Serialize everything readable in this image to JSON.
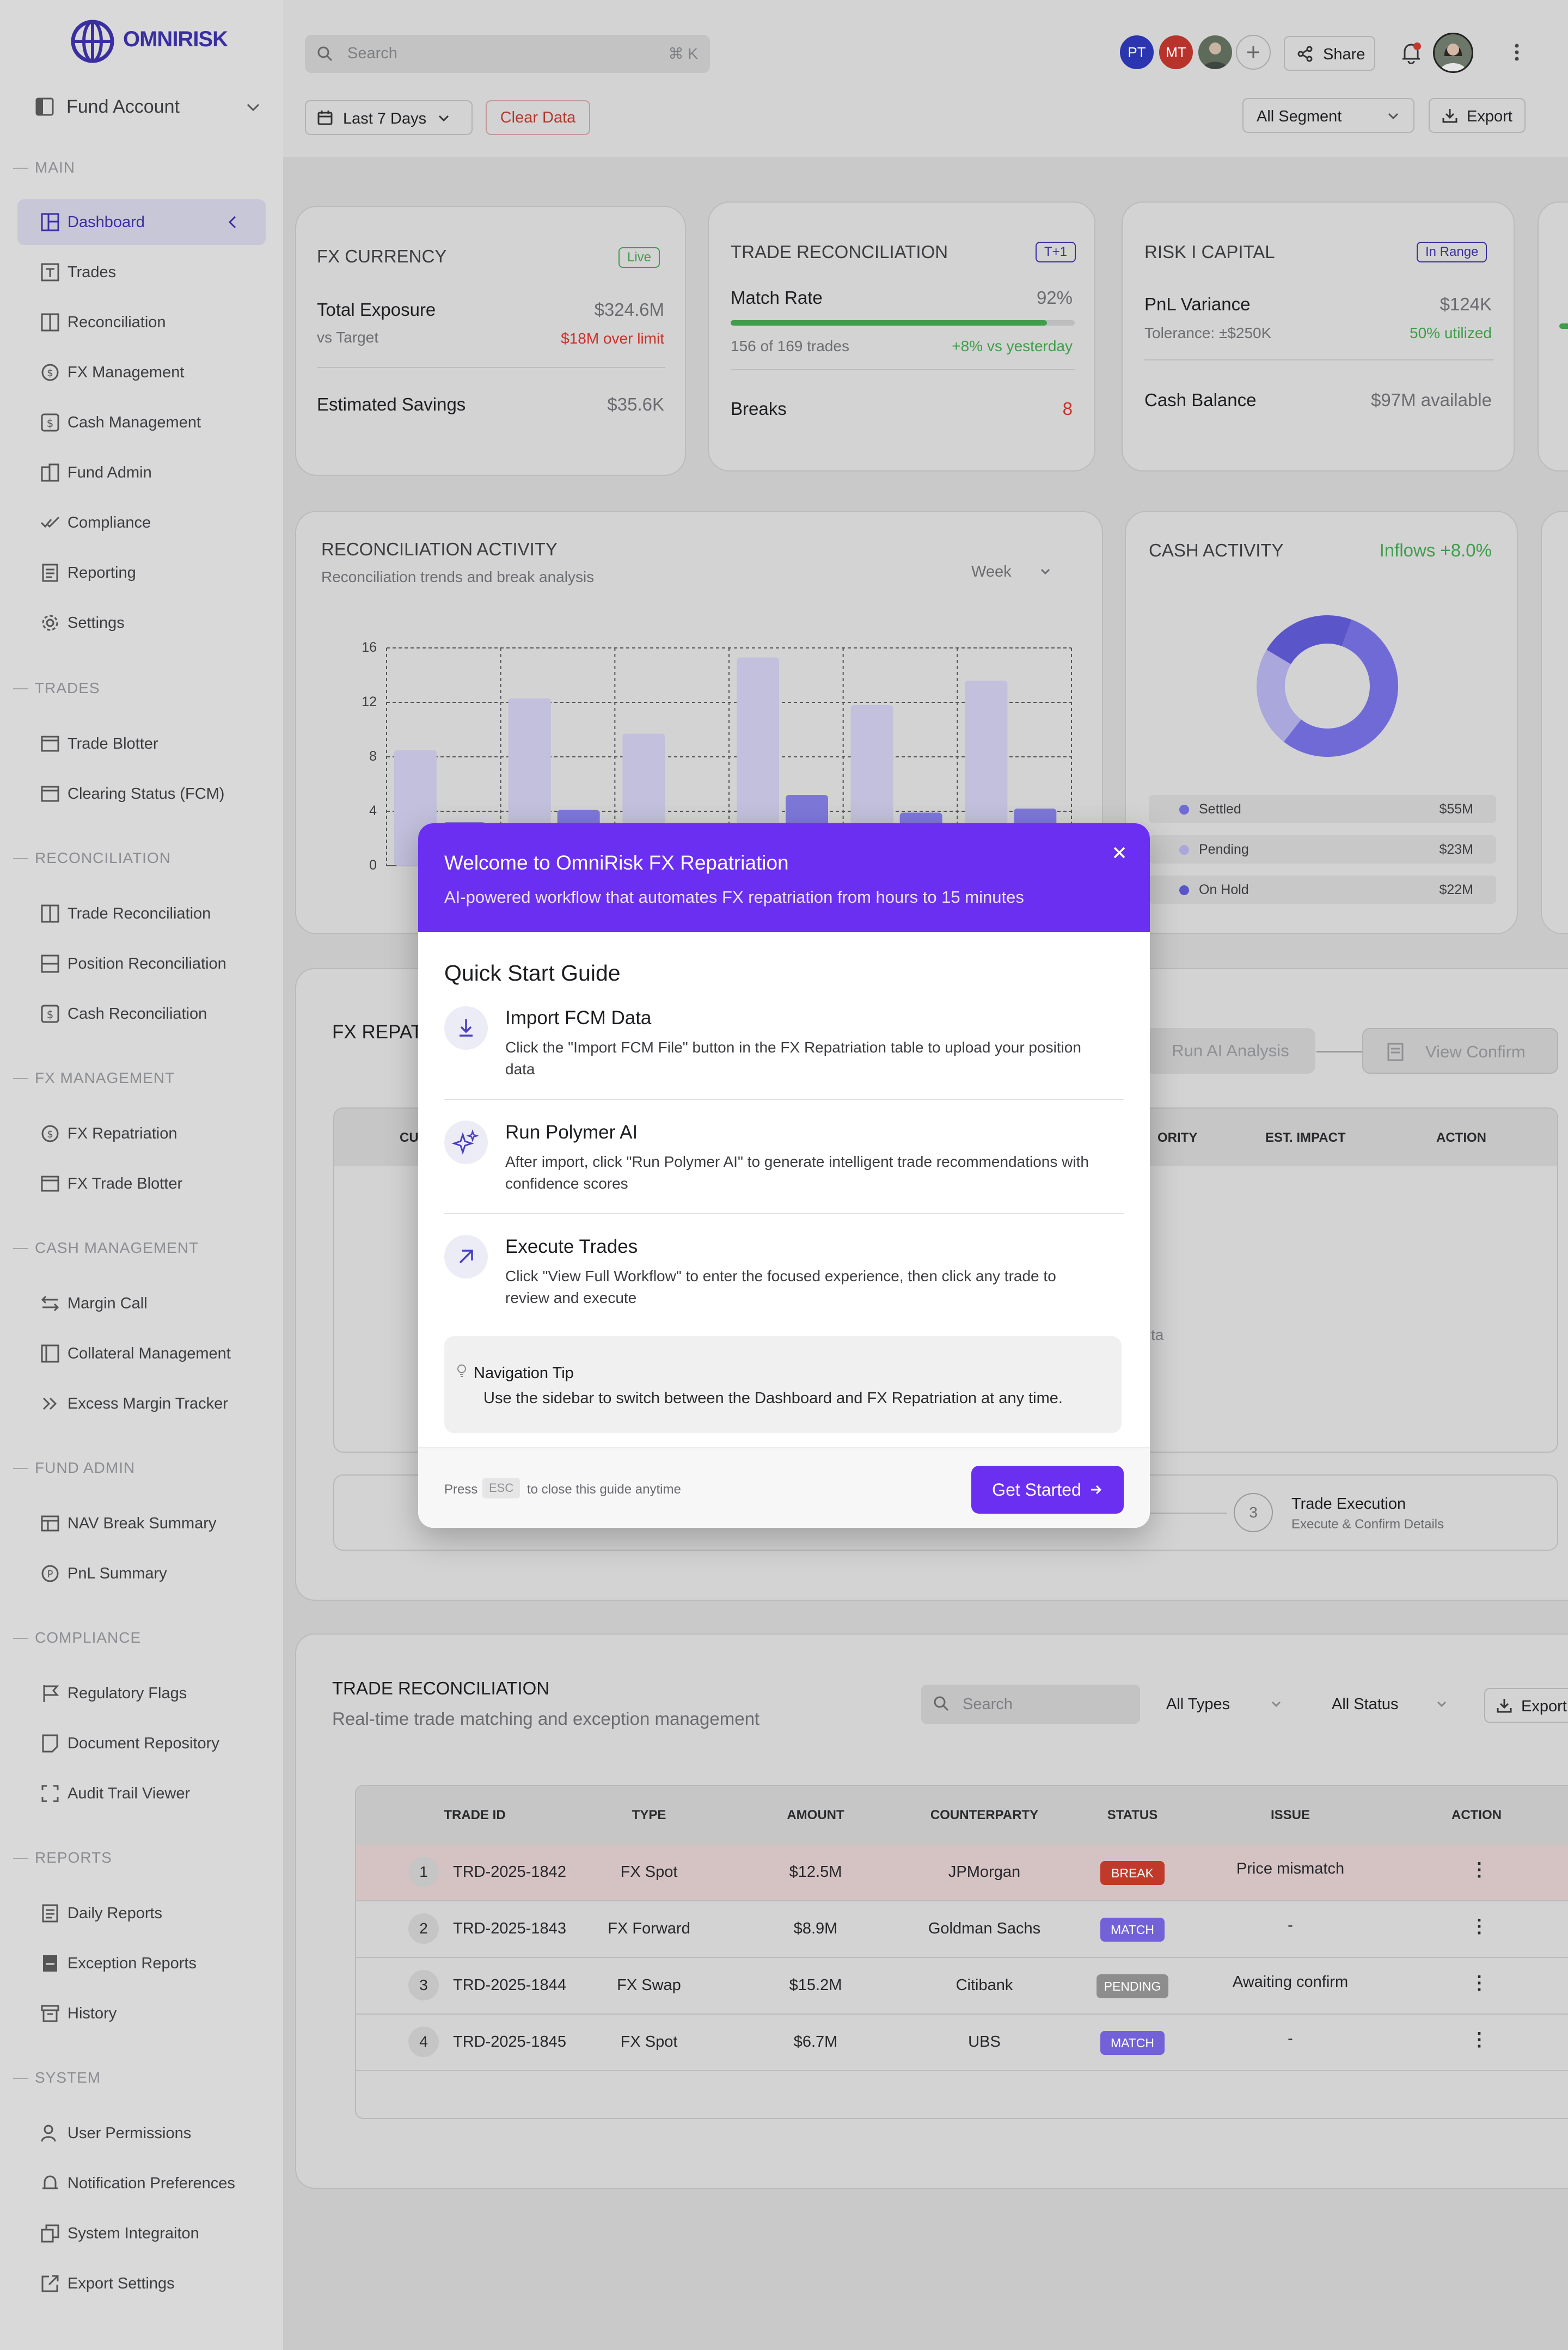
{
  "brand": {
    "logo_text": "OMNIRISK"
  },
  "sidebar": {
    "fund_selector": "Fund Account",
    "sections": {
      "main": "MAIN",
      "trades": "TRADES",
      "reconciliation": "RECONCILIATION",
      "fx_management": "FX MANAGEMENT",
      "cash_management": "CASH MANAGEMENT",
      "fund_admin": "FUND ADMIN",
      "compliance": "COMPLIANCE",
      "reports": "REPORTS",
      "system": "SYSTEM"
    },
    "items": {
      "dashboard": "Dashboard",
      "trades": "Trades",
      "reconciliation": "Reconciliation",
      "fx_management": "FX Management",
      "cash_management": "Cash Management",
      "fund_admin": "Fund Admin",
      "compliance": "Compliance",
      "reporting": "Reporting",
      "settings": "Settings",
      "trade_blotter": "Trade Blotter",
      "clearing_status": "Clearing Status (FCM)",
      "trade_reconciliation": "Trade Reconciliation",
      "position_reconciliation": "Position Reconciliation",
      "cash_reconciliation": "Cash Reconciliation",
      "fx_repatriation": "FX Repatriation",
      "fx_trade_blotter": "FX Trade Blotter",
      "margin_call": "Margin Call",
      "collateral_management": "Collateral Management",
      "excess_margin_tracker": "Excess Margin Tracker",
      "nav_break_summary": "NAV Break Summary",
      "pnl_summary": "PnL Summary",
      "regulatory_flags": "Regulatory Flags",
      "document_repository": "Document Repository",
      "audit_trail_viewer": "Audit Trail Viewer",
      "daily_reports": "Daily Reports",
      "exception_reports": "Exception Reports",
      "history": "History",
      "user_permissions": "User Permissions",
      "notification_preferences": "Notification Preferences",
      "system_integration": "System Integraiton",
      "export_settings": "Export Settings"
    }
  },
  "header": {
    "search_placeholder": "Search",
    "search_shortcut": "⌘ K",
    "avatars": [
      "PT",
      "MT"
    ],
    "share_label": "Share",
    "date_range": "Last 7 Days",
    "clear_data": "Clear Data",
    "segment": "All Segment",
    "export_label": "Export"
  },
  "cards": {
    "fx_currency": {
      "title": "FX CURRENCY",
      "tag": "Live",
      "total_exposure_label": "Total Exposure",
      "total_exposure_value": "$324.6M",
      "vs_target_label": "vs Target",
      "vs_target_value": "$18M over limit",
      "savings_label": "Estimated Savings",
      "savings_value": "$35.6K"
    },
    "trade_reconciliation": {
      "title": "TRADE RECONCILIATION",
      "tag": "T+1",
      "match_rate_label": "Match Rate",
      "match_rate_value": "92%",
      "match_rate_fraction": 0.92,
      "trades_count": "156 of 169 trades",
      "trend": "+8% vs yesterday",
      "breaks_label": "Breaks",
      "breaks_value": "8"
    },
    "risk_capital": {
      "title": "RISK I CAPITAL",
      "tag": "In Range",
      "pnl_label": "PnL Variance",
      "pnl_value": "$124K",
      "tolerance": "Tolerance: ±$250K",
      "utilized": "50% utilized",
      "cash_balance_label": "Cash Balance",
      "cash_balance_value": "$97M available"
    }
  },
  "recon_activity": {
    "title": "RECONCILIATION ACTIVITY",
    "subtitle": "Reconciliation trends and break analysis",
    "period": "Week"
  },
  "chart_data": {
    "type": "bar",
    "title": "RECONCILIATION ACTIVITY",
    "ylim": [
      0,
      16
    ],
    "yticks": [
      0,
      4,
      8,
      12,
      16
    ],
    "grid": true,
    "series": [
      {
        "values": [
          8.5,
          12.3,
          9.7,
          15.3,
          11.8,
          13.6
        ],
        "color": "#c2c0dc"
      },
      {
        "values": [
          3.2,
          4.1,
          2.6,
          5.2,
          3.9,
          4.2
        ],
        "color": "#7d78d8"
      }
    ]
  },
  "cash_activity": {
    "title": "CASH ACTIVITY",
    "inflows": "Inflows +8.0%",
    "legend": [
      {
        "label": "Settled",
        "value": "$55M",
        "amount": 55,
        "color": "#6f6ad6"
      },
      {
        "label": "Pending",
        "value": "$23M",
        "amount": 23,
        "color": "#aaa7dc"
      },
      {
        "label": "On Hold",
        "value": "$22M",
        "amount": 22,
        "color": "#5a55c8"
      }
    ]
  },
  "fx_repatriation": {
    "title_partial": "FX REPAT",
    "run_ai": "Run AI Analysis",
    "view_confirm": "View Confirm",
    "columns_partial": [
      "CU",
      "ORITY",
      "EST. IMPACT",
      "ACTION"
    ],
    "empty_partial": "ta",
    "step3_num": "3",
    "step3_title": "Trade Execution",
    "step3_sub": "Execute & Confirm Details"
  },
  "trade_table": {
    "title": "TRADE RECONCILIATION",
    "subtitle": "Real-time trade matching and exception management",
    "search_placeholder": "Search",
    "types_filter": "All Types",
    "status_filter": "All Status",
    "export_label": "Export",
    "columns": [
      "TRADE ID",
      "TYPE",
      "AMOUNT",
      "COUNTERPARTY",
      "STATUS",
      "ISSUE",
      "ACTION"
    ],
    "rows": [
      {
        "num": "1",
        "id": "TRD-2025-1842",
        "type": "FX Spot",
        "amount": "$12.5M",
        "counterparty": "JPMorgan",
        "status": "BREAK",
        "issue": "Price mismatch"
      },
      {
        "num": "2",
        "id": "TRD-2025-1843",
        "type": "FX Forward",
        "amount": "$8.9M",
        "counterparty": "Goldman Sachs",
        "status": "MATCH",
        "issue": "-"
      },
      {
        "num": "3",
        "id": "TRD-2025-1844",
        "type": "FX Swap",
        "amount": "$15.2M",
        "counterparty": "Citibank",
        "status": "PENDING",
        "issue": "Awaiting confirm"
      },
      {
        "num": "4",
        "id": "TRD-2025-1845",
        "type": "FX Spot",
        "amount": "$6.7M",
        "counterparty": "UBS",
        "status": "MATCH",
        "issue": "-"
      }
    ]
  },
  "modal": {
    "title": "Welcome to OmniRisk FX Repatriation",
    "subtitle": "AI-powered workflow that automates FX repatriation from hours to 15 minutes",
    "guide_title": "Quick Start Guide",
    "steps": [
      {
        "title": "Import FCM Data",
        "desc": "Click the \"Import FCM File\" button in the FX Repatriation table to upload your position data"
      },
      {
        "title": "Run Polymer AI",
        "desc": "After import, click \"Run Polymer AI\" to generate intelligent trade recommendations with confidence scores"
      },
      {
        "title": "Execute Trades",
        "desc": "Click \"View Full Workflow\" to enter the focused experience, then click any trade to review and execute"
      }
    ],
    "tip_title": "Navigation Tip",
    "tip_text": "Use the sidebar to switch between the Dashboard and FX Repatriation at any time.",
    "press": "Press",
    "esc": "ESC",
    "press_suffix": "to close this guide anytime",
    "cta": "Get Started"
  },
  "colors": {
    "brand_purple": "#6a2ff0",
    "brand_navy": "#3a2fa0",
    "break_red": "#c0392b",
    "match_purple": "#7361d8",
    "pending_gray": "#8d8d8d",
    "positive_green": "#3f9d4b",
    "negative_red": "#c8322a"
  }
}
